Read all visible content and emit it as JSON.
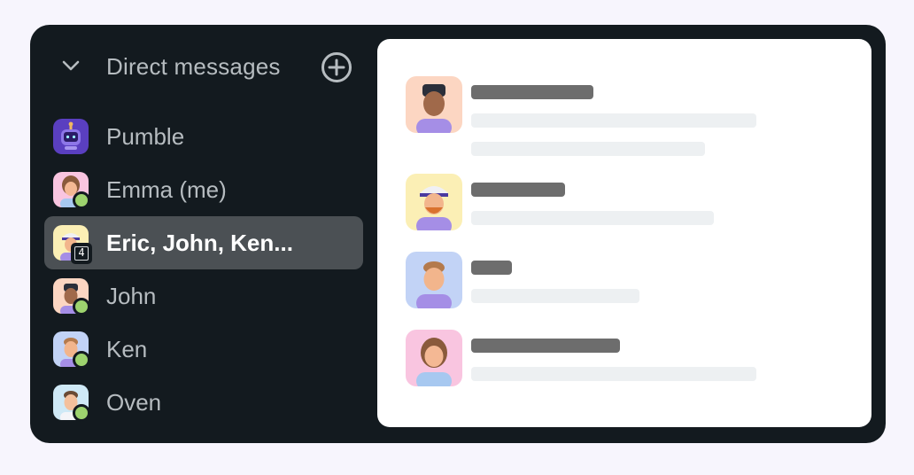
{
  "sidebar": {
    "section_title": "Direct messages",
    "items": [
      {
        "label": "Pumble",
        "avatar": "pumble-bot-avatar",
        "status": "none"
      },
      {
        "label": "Emma (me)",
        "avatar": "emma-avatar",
        "status": "online"
      },
      {
        "label": "Eric, John, Ken...",
        "avatar": "group-avatar",
        "status": "group",
        "member_count": "4",
        "active": true
      },
      {
        "label": "John",
        "avatar": "john-avatar",
        "status": "online"
      },
      {
        "label": "Ken",
        "avatar": "ken-avatar",
        "status": "online"
      },
      {
        "label": "Oven",
        "avatar": "oven-avatar",
        "status": "online"
      }
    ]
  },
  "colors": {
    "sidebar_bg": "#131a1f",
    "active_item_bg": "#4b5054",
    "online": "#9dd36e",
    "page_bg": "#f7f5fd"
  },
  "icons": [
    "chevron-down-icon",
    "add-circle-icon"
  ]
}
